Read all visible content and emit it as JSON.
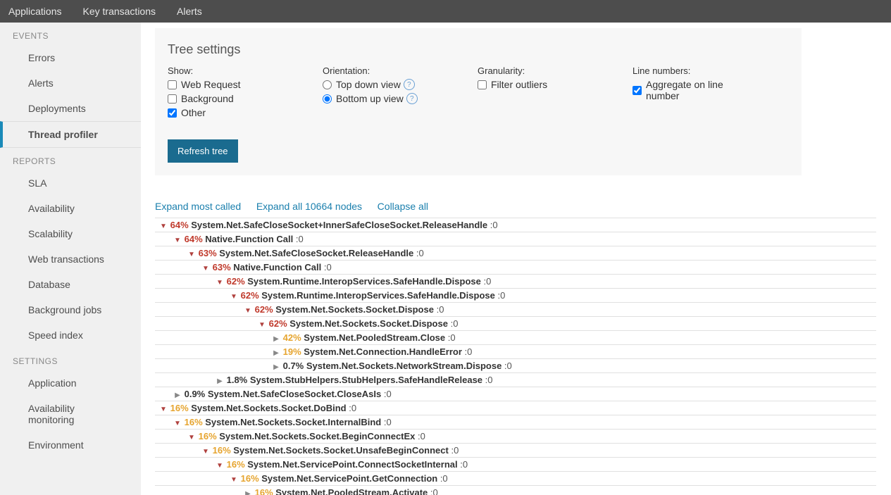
{
  "topnav": {
    "applications": "Applications",
    "key_transactions": "Key transactions",
    "alerts": "Alerts"
  },
  "sidebar": {
    "events": {
      "header": "EVENTS",
      "errors": "Errors",
      "alerts": "Alerts",
      "deployments": "Deployments",
      "thread_profiler": "Thread profiler"
    },
    "reports": {
      "header": "REPORTS",
      "sla": "SLA",
      "availability": "Availability",
      "scalability": "Scalability",
      "web_transactions": "Web transactions",
      "database": "Database",
      "background_jobs": "Background jobs",
      "speed_index": "Speed index"
    },
    "settings": {
      "header": "SETTINGS",
      "application": "Application",
      "availability_monitoring": "Availability monitoring",
      "environment": "Environment"
    }
  },
  "panel": {
    "title": "Tree settings",
    "show": {
      "label": "Show:",
      "web_request": "Web Request",
      "background": "Background",
      "other": "Other"
    },
    "orientation": {
      "label": "Orientation:",
      "top_down": "Top down view",
      "bottom_up": "Bottom up view"
    },
    "granularity": {
      "label": "Granularity:",
      "filter_outliers": "Filter outliers"
    },
    "line_numbers": {
      "label": "Line numbers:",
      "aggregate": "Aggregate on line number"
    },
    "refresh": "Refresh tree"
  },
  "actions": {
    "expand_most": "Expand most called",
    "expand_all": "Expand all 10664 nodes",
    "collapse_all": "Collapse all"
  },
  "tree": [
    {
      "depth": 0,
      "expanded": true,
      "pct_class": "red",
      "pct": "64%",
      "name": "System.Net.SafeCloseSocket+InnerSafeCloseSocket.ReleaseHandle",
      "line": ":0"
    },
    {
      "depth": 1,
      "expanded": true,
      "pct_class": "red",
      "pct": "64%",
      "name": "Native.Function Call",
      "line": ":0"
    },
    {
      "depth": 2,
      "expanded": true,
      "pct_class": "red",
      "pct": "63%",
      "name": "System.Net.SafeCloseSocket.ReleaseHandle",
      "line": ":0"
    },
    {
      "depth": 3,
      "expanded": true,
      "pct_class": "red",
      "pct": "63%",
      "name": "Native.Function Call",
      "line": ":0"
    },
    {
      "depth": 4,
      "expanded": true,
      "pct_class": "red",
      "pct": "62%",
      "name": "System.Runtime.InteropServices.SafeHandle.Dispose",
      "line": ":0"
    },
    {
      "depth": 5,
      "expanded": true,
      "pct_class": "red",
      "pct": "62%",
      "name": "System.Runtime.InteropServices.SafeHandle.Dispose",
      "line": ":0"
    },
    {
      "depth": 6,
      "expanded": true,
      "pct_class": "red",
      "pct": "62%",
      "name": "System.Net.Sockets.Socket.Dispose",
      "line": ":0"
    },
    {
      "depth": 7,
      "expanded": true,
      "pct_class": "red",
      "pct": "62%",
      "name": "System.Net.Sockets.Socket.Dispose",
      "line": ":0"
    },
    {
      "depth": 8,
      "expanded": false,
      "pct_class": "orange",
      "pct": "42%",
      "name": "System.Net.PooledStream.Close",
      "line": ":0"
    },
    {
      "depth": 8,
      "expanded": false,
      "pct_class": "orange",
      "pct": "19%",
      "name": "System.Net.Connection.HandleError",
      "line": ":0"
    },
    {
      "depth": 8,
      "expanded": false,
      "pct_class": "plain",
      "pct": "0.7%",
      "name": "System.Net.Sockets.NetworkStream.Dispose",
      "line": ":0"
    },
    {
      "depth": 4,
      "expanded": false,
      "pct_class": "plain",
      "pct": "1.8%",
      "name": "System.StubHelpers.StubHelpers.SafeHandleRelease",
      "line": ":0"
    },
    {
      "depth": 1,
      "expanded": false,
      "pct_class": "plain",
      "pct": "0.9%",
      "name": "System.Net.SafeCloseSocket.CloseAsIs",
      "line": ":0"
    },
    {
      "depth": 0,
      "expanded": true,
      "pct_class": "orange",
      "pct": "16%",
      "name": "System.Net.Sockets.Socket.DoBind",
      "line": ":0"
    },
    {
      "depth": 1,
      "expanded": true,
      "pct_class": "orange",
      "pct": "16%",
      "name": "System.Net.Sockets.Socket.InternalBind",
      "line": ":0"
    },
    {
      "depth": 2,
      "expanded": true,
      "pct_class": "orange",
      "pct": "16%",
      "name": "System.Net.Sockets.Socket.BeginConnectEx",
      "line": ":0"
    },
    {
      "depth": 3,
      "expanded": true,
      "pct_class": "orange",
      "pct": "16%",
      "name": "System.Net.Sockets.Socket.UnsafeBeginConnect",
      "line": ":0"
    },
    {
      "depth": 4,
      "expanded": true,
      "pct_class": "orange",
      "pct": "16%",
      "name": "System.Net.ServicePoint.ConnectSocketInternal",
      "line": ":0"
    },
    {
      "depth": 5,
      "expanded": true,
      "pct_class": "orange",
      "pct": "16%",
      "name": "System.Net.ServicePoint.GetConnection",
      "line": ":0"
    },
    {
      "depth": 6,
      "expanded": false,
      "pct_class": "orange",
      "pct": "16%",
      "name": "System.Net.PooledStream.Activate",
      "line": ":0"
    }
  ]
}
